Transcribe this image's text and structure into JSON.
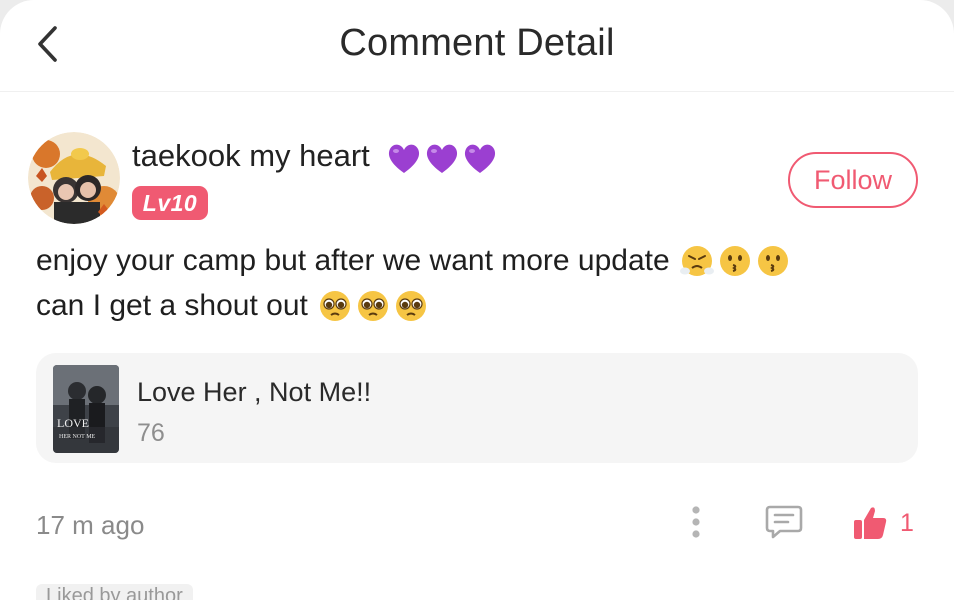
{
  "header": {
    "back_icon": "chevron-left-icon",
    "title": "Comment Detail"
  },
  "comment": {
    "username": "taekook my heart",
    "username_emojis": [
      "purple-heart",
      "purple-heart",
      "purple-heart"
    ],
    "level": "Lv10",
    "follow_label": "Follow",
    "text_line1": "enjoy your camp but after we want more update",
    "text_line1_emojis": [
      "face-with-steam",
      "kissing-face",
      "kissing-face"
    ],
    "text_line2": "can I get a shout out",
    "text_line2_emojis": [
      "pleading-face",
      "pleading-face",
      "pleading-face"
    ],
    "time": "17 m ago",
    "like_count": "1",
    "liked_by_author": "Liked by author"
  },
  "book": {
    "title": "Love Her , Not Me!!",
    "count": "76",
    "cover_text_1": "LOVE",
    "cover_text_2": "HER NOT ME"
  },
  "colors": {
    "accent": "#f05a72",
    "card_bg": "#f5f5f5",
    "muted_text": "#8a8a8a"
  }
}
